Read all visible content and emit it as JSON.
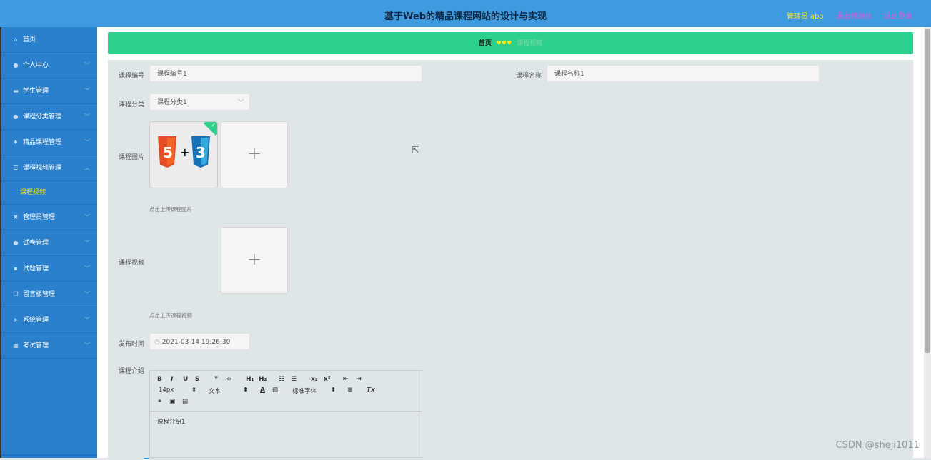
{
  "header": {
    "title": "基于Web的精品课程网站的设计与实现",
    "admin": "管理员 abo",
    "back_label": "退出到前台",
    "logout_label": "退出登录"
  },
  "sidebar": {
    "items": [
      {
        "label": "首页",
        "icon": "home-icon"
      },
      {
        "label": "个人中心",
        "icon": "user-icon"
      },
      {
        "label": "学生管理",
        "icon": "monitor-icon"
      },
      {
        "label": "课程分类管理",
        "icon": "user-icon"
      },
      {
        "label": "精品课程管理",
        "icon": "pin-icon"
      },
      {
        "label": "课程视频管理",
        "icon": "sliders-icon",
        "expanded": true
      },
      {
        "label": "管理员管理",
        "icon": "ticket-icon"
      },
      {
        "label": "试卷管理",
        "icon": "user-icon"
      },
      {
        "label": "试题管理",
        "icon": "chat-icon"
      },
      {
        "label": "留言板管理",
        "icon": "copy-icon"
      },
      {
        "label": "系统管理",
        "icon": "send-icon"
      },
      {
        "label": "考试管理",
        "icon": "grid-icon"
      }
    ],
    "sub_item": "课程视频"
  },
  "breadcrumb": {
    "home": "首页",
    "current": "课程视频"
  },
  "form": {
    "course_no_label": "课程编号",
    "course_no_value": "课程编号1",
    "course_name_label": "课程名称",
    "course_name_value": "课程名称1",
    "category_label": "课程分类",
    "category_value": "课程分类1",
    "image_label": "课程图片",
    "image_hint": "点击上传课程图片",
    "video_label": "课程视频",
    "video_hint": "点击上传课程视频",
    "publish_label": "发布时间",
    "publish_value": "2021-03-14 19:26:30",
    "intro_label": "课程介绍",
    "intro_content": "课程介绍1"
  },
  "editor": {
    "font_size": "14px",
    "text_style": "文本",
    "font_family": "标准字体"
  },
  "watermark": "CSDN @sheji1011"
}
